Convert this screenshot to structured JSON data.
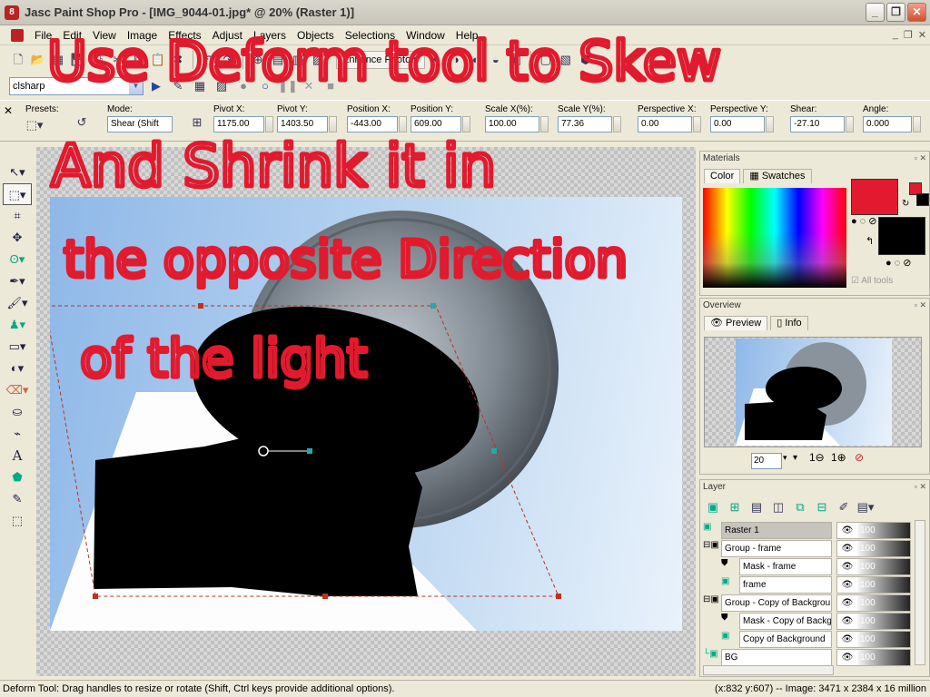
{
  "window": {
    "title": "Jasc Paint Shop Pro - [IMG_9044-01.jpg* @ 20% (Raster 1)]"
  },
  "menu": [
    "File",
    "Edit",
    "View",
    "Image",
    "Effects",
    "Adjust",
    "Layers",
    "Objects",
    "Selections",
    "Window",
    "Help"
  ],
  "toolbar": {
    "enhance_label": "Enhance Photo",
    "script_name": "clsharp"
  },
  "tool_options": {
    "presets_label": "Presets:",
    "mode_label": "Mode:",
    "mode_value": "Shear (Shift",
    "pivot_x_label": "Pivot X:",
    "pivot_x": "1175.00",
    "pivot_y_label": "Pivot Y:",
    "pivot_y": "1403.50",
    "position_x_label": "Position X:",
    "position_x": "-443.00",
    "position_y_label": "Position Y:",
    "position_y": "609.00",
    "scale_x_label": "Scale X(%):",
    "scale_x": "100.00",
    "scale_y_label": "Scale Y(%):",
    "scale_y": "77.36",
    "perspective_x_label": "Perspective X:",
    "perspective_x": "0.00",
    "perspective_y_label": "Perspective Y:",
    "perspective_y": "0.00",
    "shear_label": "Shear:",
    "shear": "-27.10",
    "angle_label": "Angle:",
    "angle": "0.000"
  },
  "annotation": {
    "line1": "Use Deform tool to Skew",
    "line2": "And Shrink it in",
    "line3": "the opposite Direction",
    "line4": "of the light",
    "color": "#e21a2e"
  },
  "materials": {
    "title": "Materials",
    "tab_color": "Color",
    "tab_swatches": "Swatches",
    "all_tools": "All tools",
    "fg_color": "#e31a2f",
    "bg_color": "#000000"
  },
  "overview": {
    "title": "Overview",
    "tab_preview": "Preview",
    "tab_info": "Info",
    "zoom": "20"
  },
  "layers": {
    "title": "Layer",
    "items": [
      {
        "name": "Raster 1",
        "opacity": "100"
      },
      {
        "name": "Group - frame",
        "opacity": "100"
      },
      {
        "name": "Mask - frame",
        "opacity": "100"
      },
      {
        "name": "frame",
        "opacity": "100"
      },
      {
        "name": "Group - Copy of Backgrou",
        "opacity": "100"
      },
      {
        "name": "Mask - Copy of Backg",
        "opacity": "100"
      },
      {
        "name": "Copy of Background",
        "opacity": "100"
      },
      {
        "name": "BG",
        "opacity": "100"
      }
    ]
  },
  "status": {
    "left": "Deform Tool: Drag handles to resize or rotate (Shift, Ctrl keys provide additional options).",
    "right": "(x:832 y:607) -- Image:  3471 x 2384 x 16 million"
  }
}
